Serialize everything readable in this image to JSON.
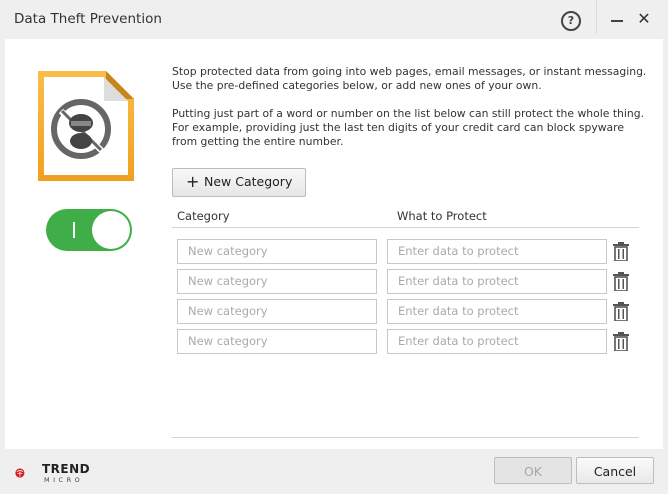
{
  "window": {
    "title": "Data Theft Prevention",
    "help_label": "?",
    "close_label": "✕"
  },
  "feature": {
    "icon": "data-theft-shield-icon",
    "toggle_state": "on",
    "toggle_label": "I"
  },
  "description": {
    "line1": "Stop protected data from going into web pages, email messages, or instant messaging. Use the pre-defined categories below, or add new ones of your own.",
    "line2": "Putting just part of a word or number on the list below can still protect the whole thing. For example, providing just the last ten digits of your credit card can block spyware from getting the entire number."
  },
  "actions": {
    "new_category_plus": "+",
    "new_category_label": "New Category"
  },
  "table": {
    "columns": [
      "Category",
      "What to Protect"
    ],
    "rows": [
      {
        "category_placeholder": "New category",
        "protect_placeholder": "Enter data to protect"
      },
      {
        "category_placeholder": "New category",
        "protect_placeholder": "Enter data to protect"
      },
      {
        "category_placeholder": "New category",
        "protect_placeholder": "Enter data to protect"
      },
      {
        "category_placeholder": "New category",
        "protect_placeholder": "Enter data to protect"
      }
    ]
  },
  "footer": {
    "brand_line1": "TREND",
    "brand_line2": "MICRO",
    "ok_label": "OK",
    "cancel_label": "Cancel"
  },
  "colors": {
    "toggle_on": "#3fae48",
    "doc_orange": "#f5a623",
    "brand_red": "#d71920"
  }
}
